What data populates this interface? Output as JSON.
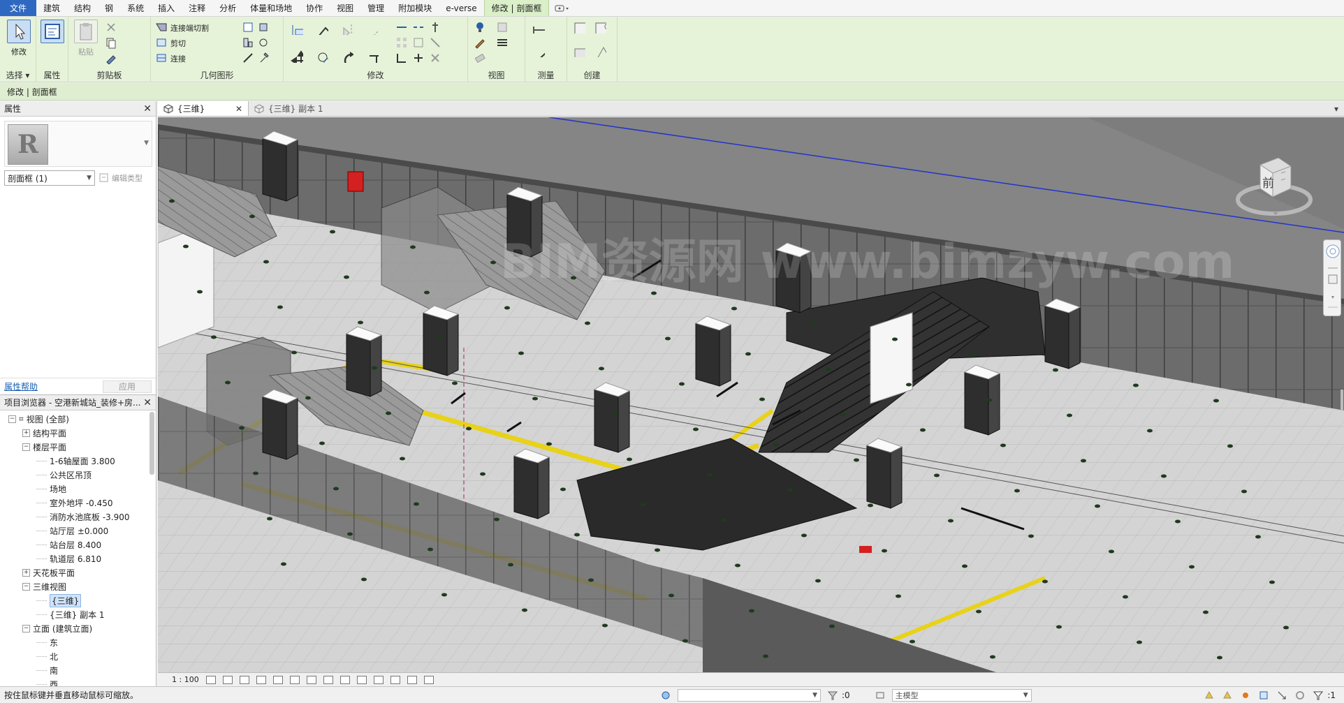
{
  "menu_tabs": [
    "文件",
    "建筑",
    "结构",
    "钢",
    "系统",
    "插入",
    "注释",
    "分析",
    "体量和场地",
    "协作",
    "视图",
    "管理",
    "附加模块",
    "e-verse",
    "修改 | 剖面框"
  ],
  "ribbon": {
    "select": {
      "button": "修改",
      "group": "选择"
    },
    "properties": {
      "group": "属性"
    },
    "clipboard": {
      "paste": "粘贴",
      "group": "剪贴板"
    },
    "geometry": {
      "cut_join": "连接端切割",
      "cut": "剪切",
      "join": "连接",
      "group": "几何图形"
    },
    "modify": {
      "group": "修改"
    },
    "view": {
      "group": "视图"
    },
    "measure": {
      "group": "测量"
    },
    "create": {
      "group": "创建"
    }
  },
  "context_label": "修改 | 剖面框",
  "properties_panel": {
    "title": "属性",
    "logo_letter": "R",
    "instance_selector": "剖面框 (1)",
    "edit_type": "编辑类型",
    "help_link": "属性帮助",
    "apply": "应用"
  },
  "project_browser": {
    "title": "项目浏览器 - 空港新城站_装修+房...",
    "items": [
      {
        "label": "视图 (全部)",
        "level": 0,
        "toggle": "−"
      },
      {
        "label": "结构平面",
        "level": 1,
        "toggle": "+"
      },
      {
        "label": "楼层平面",
        "level": 1,
        "toggle": "−"
      },
      {
        "label": "1-6轴屋面 3.800",
        "level": 2,
        "toggle": ""
      },
      {
        "label": "公共区吊顶",
        "level": 2,
        "toggle": ""
      },
      {
        "label": "场地",
        "level": 2,
        "toggle": ""
      },
      {
        "label": "室外地坪 -0.450",
        "level": 2,
        "toggle": ""
      },
      {
        "label": "消防水池底板 -3.900",
        "level": 2,
        "toggle": ""
      },
      {
        "label": "站厅层 ±0.000",
        "level": 2,
        "toggle": ""
      },
      {
        "label": "站台层 8.400",
        "level": 2,
        "toggle": ""
      },
      {
        "label": "轨道层 6.810",
        "level": 2,
        "toggle": ""
      },
      {
        "label": "天花板平面",
        "level": 1,
        "toggle": "+"
      },
      {
        "label": "三维视图",
        "level": 1,
        "toggle": "−"
      },
      {
        "label": "{三维}",
        "level": 2,
        "toggle": "",
        "selected": true
      },
      {
        "label": "{三维} 副本 1",
        "level": 2,
        "toggle": ""
      },
      {
        "label": "立面 (建筑立面)",
        "level": 1,
        "toggle": "−"
      },
      {
        "label": "东",
        "level": 2,
        "toggle": ""
      },
      {
        "label": "北",
        "level": 2,
        "toggle": ""
      },
      {
        "label": "南",
        "level": 2,
        "toggle": ""
      },
      {
        "label": "西",
        "level": 2,
        "toggle": ""
      }
    ]
  },
  "view_tabs": [
    {
      "label": "{三维}",
      "active": true
    },
    {
      "label": "{三维} 副本 1",
      "active": false
    }
  ],
  "viewcube": {
    "face_label": "前"
  },
  "watermark": "BIM资源网 www.bimzyw.com",
  "view_control": {
    "scale": "1 : 100"
  },
  "status_bar": {
    "message": "按住鼠标键并垂直移动鼠标可缩放。",
    "select_count": ":0",
    "model_field": "主模型",
    "filter_count": ":1"
  },
  "colors": {
    "file_tab": "#2f68c0",
    "ribbon_bg": "#e6f3d9",
    "viewport_bg": "#858585",
    "floor": "#d6d6d6",
    "yellow_line": "#e8d21a",
    "blue_line": "#2233cc"
  }
}
